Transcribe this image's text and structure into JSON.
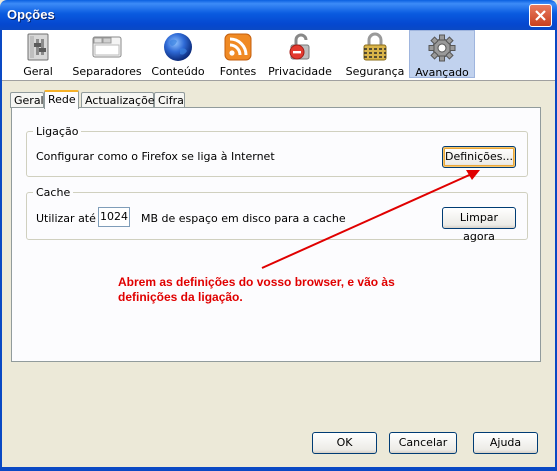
{
  "window": {
    "title": "Opções"
  },
  "toolbar": {
    "items": [
      {
        "label": "Geral",
        "icon": "general-icon"
      },
      {
        "label": "Separadores",
        "icon": "tabs-icon"
      },
      {
        "label": "Conteúdo",
        "icon": "content-icon"
      },
      {
        "label": "Fontes",
        "icon": "feeds-icon"
      },
      {
        "label": "Privacidade",
        "icon": "privacy-icon"
      },
      {
        "label": "Segurança",
        "icon": "security-icon"
      },
      {
        "label": "Avançado",
        "icon": "advanced-icon",
        "selected": true
      }
    ]
  },
  "subtabs": {
    "items": [
      {
        "label": "Geral"
      },
      {
        "label": "Rede",
        "active": true
      },
      {
        "label": "Actualizações"
      },
      {
        "label": "Cifra"
      }
    ]
  },
  "connection": {
    "legend": "Ligação",
    "description": "Configurar como o Firefox se liga à Internet",
    "settings_button": "Definições..."
  },
  "cache": {
    "legend": "Cache",
    "use_prefix": "Utilizar até",
    "size_value": "1024",
    "size_suffix": "MB de espaço em disco para a cache",
    "clear_button": "Limpar agora"
  },
  "annotation": {
    "text": "Abrem as definições do vosso browser, e vão às definições da ligação.",
    "color": "#e00000"
  },
  "footer": {
    "ok": "OK",
    "cancel": "Cancelar",
    "help": "Ajuda"
  },
  "colors": {
    "titlebar": "#0a5be0",
    "selected_toolbar": "#c1d2ee",
    "dialog_bg": "#ece9d8"
  }
}
